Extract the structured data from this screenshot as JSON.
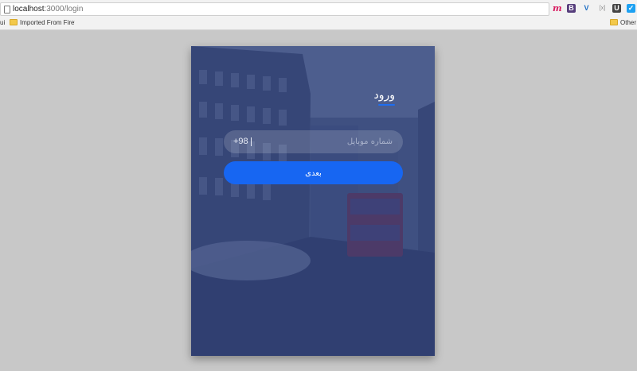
{
  "browser": {
    "url_host": "localhost",
    "url_path": ":3000/login",
    "extensions": [
      "m",
      "B",
      "V",
      "[x]",
      "U",
      "✓"
    ],
    "bookmarks": {
      "edge_fragment": "ui",
      "imported": "Imported From Firefox",
      "other": "Other b"
    }
  },
  "login": {
    "title": "ورود",
    "phone_prefix": "+98",
    "phone_placeholder": "شماره موبایل",
    "phone_value": "",
    "next_label": "بعدی"
  },
  "colors": {
    "page_bg": "#c8c8c8",
    "card_overlay": "#354574",
    "accent": "#1766f2"
  }
}
